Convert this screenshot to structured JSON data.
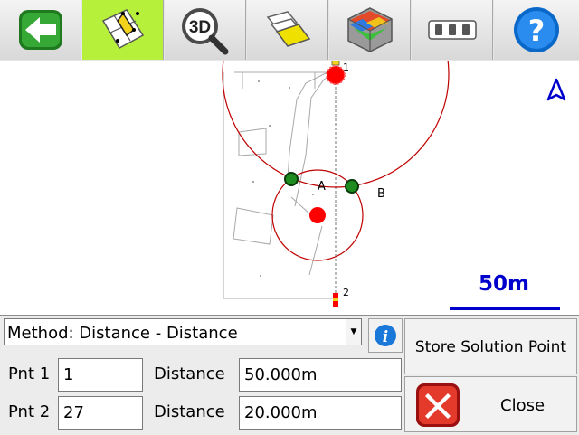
{
  "toolbar": {
    "buttons": [
      {
        "name": "back",
        "icon": "back-arrow-icon"
      },
      {
        "name": "cogo-points",
        "icon": "cogo-grid-icon",
        "active": true
      },
      {
        "name": "3d-view",
        "icon": "3d-magnifier-icon",
        "label": "3D"
      },
      {
        "name": "layers",
        "icon": "layers-icon"
      },
      {
        "name": "surface",
        "icon": "surface-cube-icon"
      },
      {
        "name": "more",
        "icon": "ellipsis-icon"
      },
      {
        "name": "help",
        "icon": "help-icon",
        "label": "?"
      }
    ]
  },
  "map": {
    "labels": {
      "point1": "1",
      "point2": "2",
      "sol_a": "A",
      "sol_b": "B"
    },
    "scale_label": "50m",
    "colors": {
      "circle": "#c00000",
      "point": "#ff0000",
      "solution": "#1e8c1e",
      "scale": "#0000cc"
    }
  },
  "form": {
    "method": "Method: Distance - Distance",
    "pnt1_label": "Pnt 1",
    "pnt1_value": "1",
    "pnt2_label": "Pnt 2",
    "pnt2_value": "27",
    "dist_label": "Distance",
    "dist1_value": "50.000m",
    "dist2_value": "20.000m"
  },
  "buttons": {
    "store": "Store Solution Point",
    "close": "Close"
  }
}
